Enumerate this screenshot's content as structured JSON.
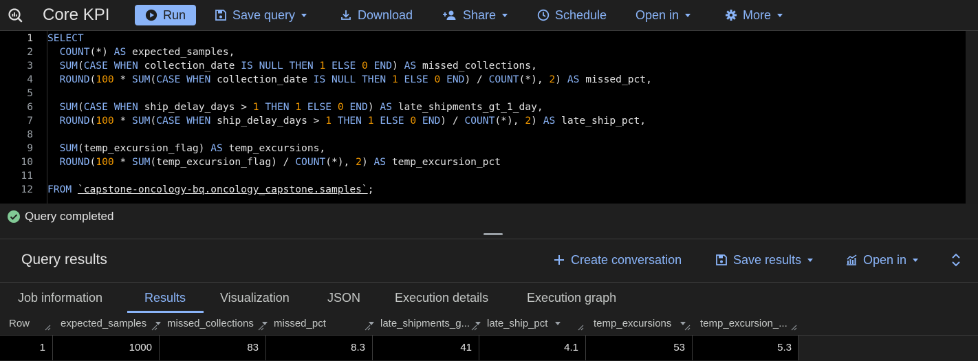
{
  "toolbar": {
    "logo_icon": "bigquery-logo-icon",
    "title": "Core KPI",
    "run_label": "Run",
    "save_query_label": "Save query",
    "download_label": "Download",
    "share_label": "Share",
    "schedule_label": "Schedule",
    "open_in_label": "Open in",
    "more_label": "More"
  },
  "editor": {
    "line_numbers": [
      "1",
      "2",
      "3",
      "4",
      "5",
      "6",
      "7",
      "8",
      "9",
      "10",
      "11",
      "12"
    ],
    "lines": [
      "SELECT",
      "  COUNT(*) AS expected_samples,",
      "  SUM(CASE WHEN collection_date IS NULL THEN 1 ELSE 0 END) AS missed_collections,",
      "  ROUND(100 * SUM(CASE WHEN collection_date IS NULL THEN 1 ELSE 0 END) / COUNT(*), 2) AS missed_pct,",
      "",
      "  SUM(CASE WHEN ship_delay_days > 1 THEN 1 ELSE 0 END) AS late_shipments_gt_1_day,",
      "  ROUND(100 * SUM(CASE WHEN ship_delay_days > 1 THEN 1 ELSE 0 END) / COUNT(*), 2) AS late_ship_pct,",
      "",
      "  SUM(temp_excursion_flag) AS temp_excursions,",
      "  ROUND(100 * SUM(temp_excursion_flag) / COUNT(*), 2) AS temp_excursion_pct",
      "",
      "FROM `capstone-oncology-bq.oncology_capstone.samples`;"
    ]
  },
  "status": {
    "text": "Query completed",
    "icon": "check-circle-icon",
    "color": "#81c995"
  },
  "results": {
    "title": "Query results",
    "create_conversation_label": "Create conversation",
    "save_results_label": "Save results",
    "open_in_label": "Open in",
    "tabs": [
      "Job information",
      "Results",
      "Visualization",
      "JSON",
      "Execution details",
      "Execution graph"
    ],
    "active_tab": "Results"
  },
  "table": {
    "columns": [
      "Row",
      "expected_samples",
      "missed_collections",
      "missed_pct",
      "late_shipments_g...",
      "late_ship_pct",
      "temp_excursions",
      "temp_excursion_..."
    ],
    "rows": [
      [
        "1",
        "1000",
        "83",
        "8.3",
        "41",
        "4.1",
        "53",
        "5.3"
      ]
    ]
  },
  "colors": {
    "accent": "#8ab4f8",
    "background": "#1f1f1f",
    "editor_background": "#000000",
    "number": "#f29900"
  }
}
